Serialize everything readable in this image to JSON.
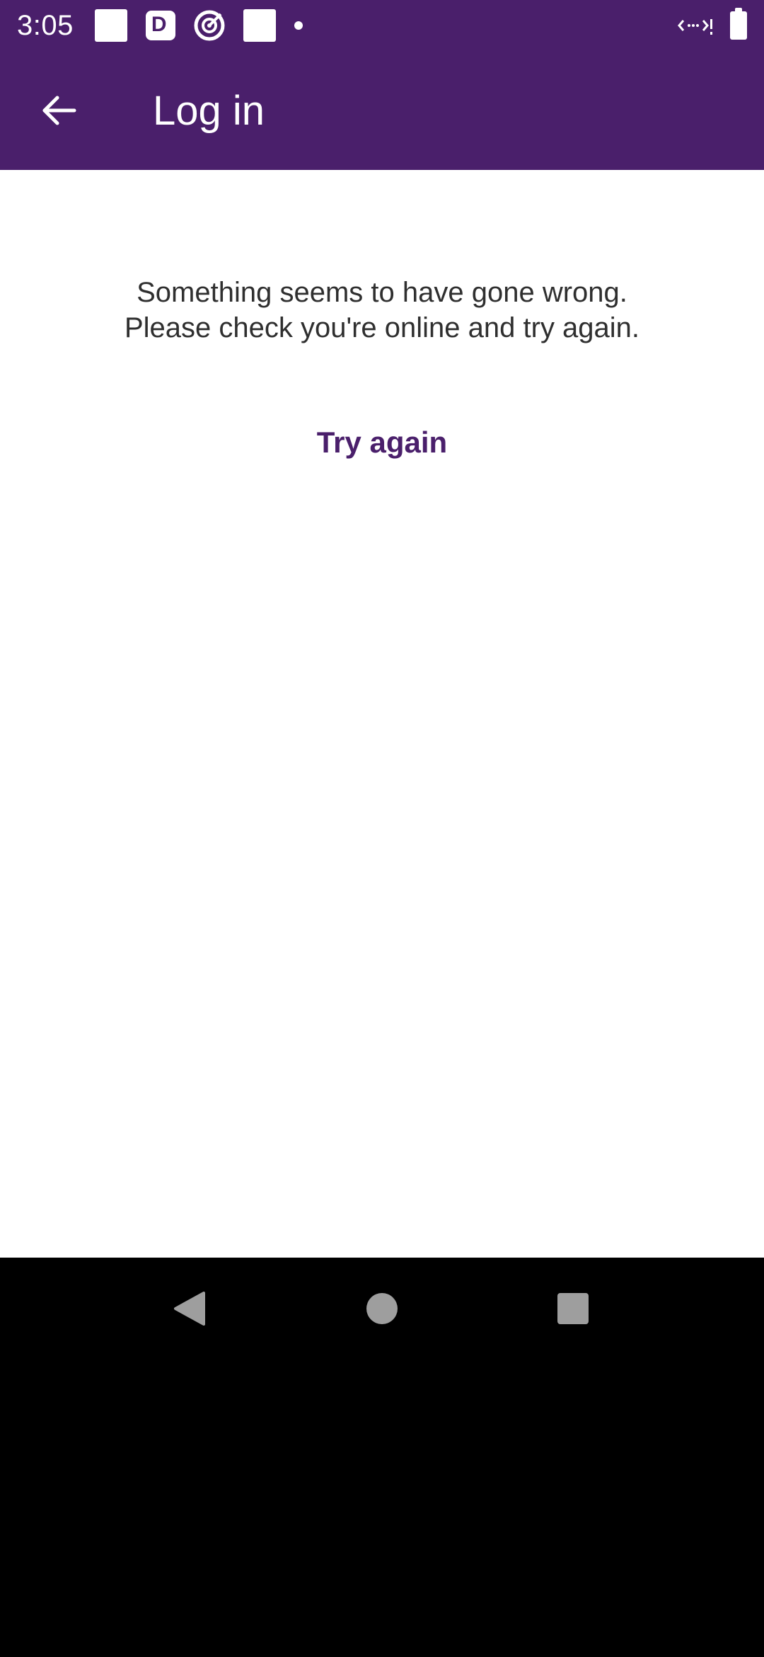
{
  "status_bar": {
    "time": "3:05"
  },
  "app_bar": {
    "title": "Log in",
    "back_icon": "arrow-left-icon"
  },
  "error": {
    "line1": "Something seems to have gone wrong.",
    "line2": "Please check you're online and try again.",
    "retry_label": "Try again"
  },
  "nav_bar": {
    "back_icon": "triangle-back-icon",
    "home_icon": "circle-home-icon",
    "recents_icon": "square-recents-icon"
  },
  "colors": {
    "brand": "#4a1f6b",
    "background": "#ffffff",
    "text": "#2f2f2f"
  }
}
